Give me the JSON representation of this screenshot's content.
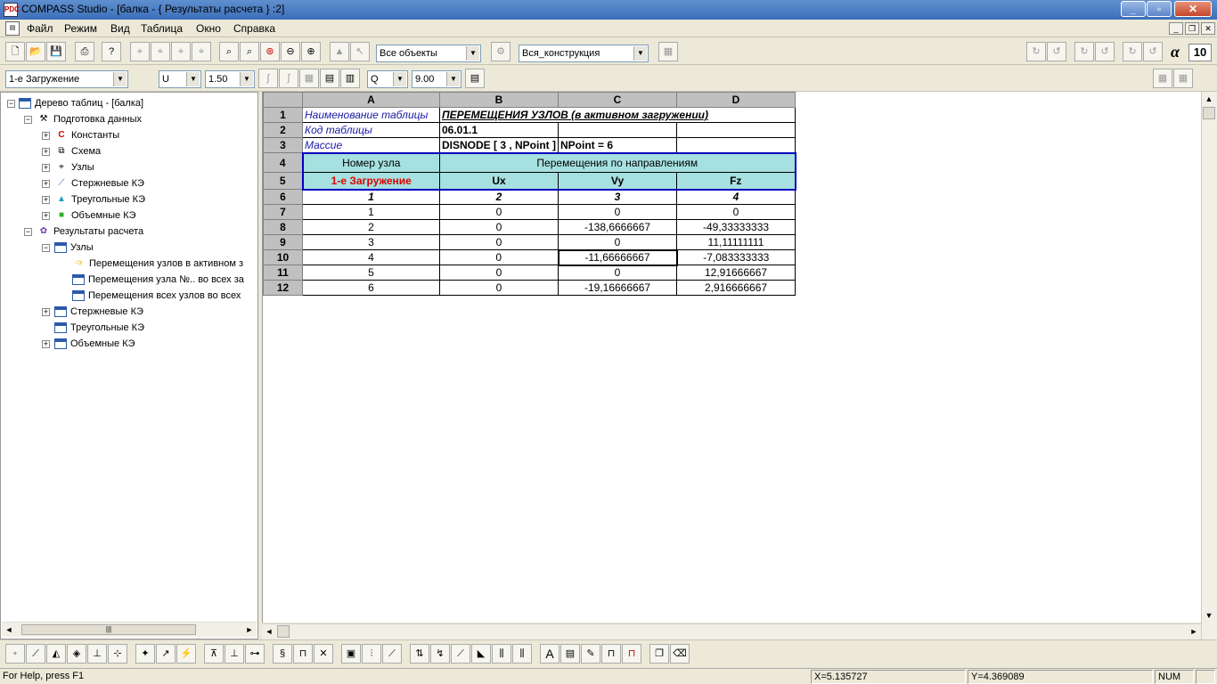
{
  "window": {
    "title": "COMPASS  Studio - [балка - { Результаты расчета } :2]",
    "app_icon": "pdc-icon"
  },
  "menu": [
    "Файл",
    "Режим",
    "Вид",
    "Таблица",
    "Окно",
    "Справка"
  ],
  "toolbar1": {
    "objects_filter": "Все объекты",
    "construction_filter": "Вся_конструкция",
    "alpha_label": "α",
    "alpha_value": "10"
  },
  "toolbar2": {
    "load_case": "1-е Загружение",
    "component": "U",
    "scale": "1.50",
    "component2": "Q",
    "scale2": "9.00"
  },
  "tree": {
    "root": "Дерево таблиц - [балка]",
    "items": [
      {
        "label": "Подготовка данных",
        "icon": "tools-icon"
      },
      {
        "label": "Константы",
        "icon": "constants-icon"
      },
      {
        "label": "Схема",
        "icon": "scheme-icon"
      },
      {
        "label": "Узлы",
        "icon": "node-icon"
      },
      {
        "label": "Стержневые КЭ",
        "icon": "rod-icon"
      },
      {
        "label": "Треугольные КЭ",
        "icon": "triangle-icon"
      },
      {
        "label": "Объемные КЭ",
        "icon": "volume-icon"
      },
      {
        "label": "Результаты расчета",
        "icon": "results-icon"
      },
      {
        "label": "Узлы",
        "icon": "table-icon"
      },
      {
        "label": "Перемещения узлов в активном з",
        "icon": "arrow-right-icon"
      },
      {
        "label": "Перемещения узла №.. во всех за",
        "icon": "table-icon"
      },
      {
        "label": "Перемещения всех узлов во всех",
        "icon": "table-icon"
      },
      {
        "label": "Стержневые КЭ",
        "icon": "table-icon"
      },
      {
        "label": "Треугольные КЭ",
        "icon": "table-icon"
      },
      {
        "label": "Объемные КЭ",
        "icon": "table-icon"
      }
    ]
  },
  "grid": {
    "columns": [
      "A",
      "B",
      "C",
      "D"
    ],
    "row_numbers": [
      "1",
      "2",
      "3",
      "4",
      "5",
      "6",
      "7",
      "8",
      "9",
      "10",
      "11",
      "12"
    ],
    "r1": {
      "a": "Наименование  таблицы",
      "b": "ПЕРЕМЕЩЕНИЯ УЗЛОВ (в активном загружении)"
    },
    "r2": {
      "a": "Код таблицы",
      "b": "06.01.1"
    },
    "r3": {
      "a": "Массие",
      "b": "DISNODE [ 3 , NPoint ]",
      "c": "NPoint = 6"
    },
    "r4": {
      "a": "Номер узла",
      "b": "Перемещения по направлениям"
    },
    "r5": {
      "a": "1-е Загружение",
      "b": "Ux",
      "c": "Vy",
      "d": "Fz"
    },
    "r6": {
      "a": "1",
      "b": "2",
      "c": "3",
      "d": "4"
    },
    "data": [
      [
        "1",
        "0",
        "0",
        "0"
      ],
      [
        "2",
        "0",
        "-138,6666667",
        "-49,33333333"
      ],
      [
        "3",
        "0",
        "0",
        "11,11111111"
      ],
      [
        "4",
        "0",
        "-11,66666667",
        "-7,083333333"
      ],
      [
        "5",
        "0",
        "0",
        "12,91666667"
      ],
      [
        "6",
        "0",
        "-19,16666667",
        "2,916666667"
      ]
    ]
  },
  "status": {
    "help": "For Help, press F1",
    "x": "X=5.135727",
    "y": "Y=4.369089",
    "num": "NUM"
  }
}
